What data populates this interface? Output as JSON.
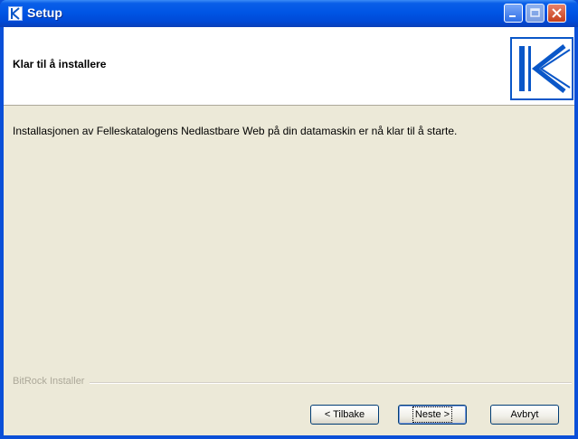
{
  "window": {
    "title": "Setup"
  },
  "header": {
    "title": "Klar til å installere"
  },
  "main": {
    "message": "Installasjonen av Felleskatalogens Nedlastbare Web på din datamaskin er nå klar til å starte."
  },
  "footer": {
    "brand": "BitRock Installer",
    "buttons": {
      "back": "< Tilbake",
      "next": "Neste >",
      "cancel": "Avbryt"
    }
  },
  "colors": {
    "titlebar": "#0055e5",
    "dialog_bg": "#ece9d8",
    "header_bg": "#ffffff",
    "logo": "#0a57c8"
  }
}
